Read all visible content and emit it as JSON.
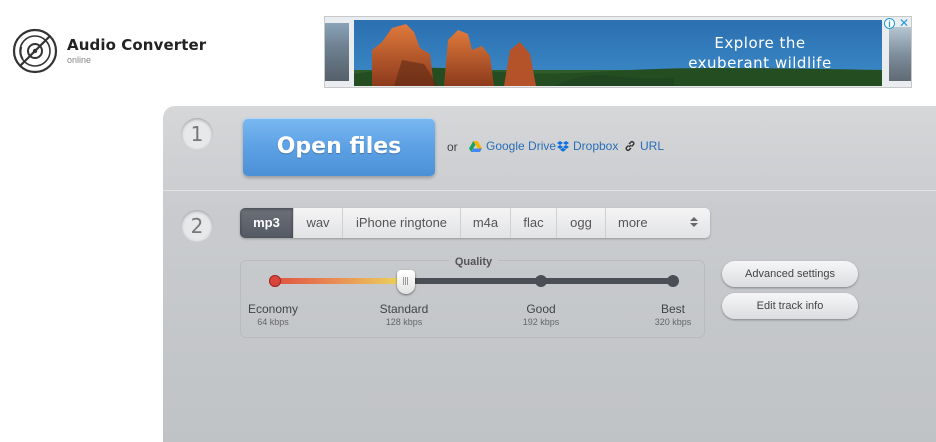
{
  "header": {
    "title": "Audio Converter",
    "subtitle": "online",
    "logo_icon": "vinyl-disc-icon"
  },
  "ad": {
    "text_line1": "Explore the",
    "text_line2": "exuberant wildlife",
    "info_icon": "i",
    "close_icon": "✕"
  },
  "step1": {
    "number": "1",
    "open_label": "Open files",
    "or_text": "or",
    "sources": [
      {
        "label": "Google Drive",
        "icon": "google-drive-icon"
      },
      {
        "label": "Dropbox",
        "icon": "dropbox-icon"
      },
      {
        "label": "URL",
        "icon": "link-icon"
      }
    ]
  },
  "step2": {
    "number": "2",
    "formats": [
      "mp3",
      "wav",
      "iPhone ringtone",
      "m4a",
      "flac",
      "ogg",
      "more"
    ],
    "active_format": "mp3",
    "quality": {
      "title": "Quality",
      "selected_index": 1,
      "stops": [
        {
          "name": "Economy",
          "kbps": "64 kbps"
        },
        {
          "name": "Standard",
          "kbps": "128 kbps"
        },
        {
          "name": "Good",
          "kbps": "192 kbps"
        },
        {
          "name": "Best",
          "kbps": "320 kbps"
        }
      ]
    },
    "advanced_label": "Advanced settings",
    "edit_label": "Edit track info"
  },
  "colors": {
    "accent_blue": "#5fa3e6",
    "link_blue": "#2a6fb7",
    "active_tab": "#5e626b",
    "panel": "#c9cbce"
  }
}
